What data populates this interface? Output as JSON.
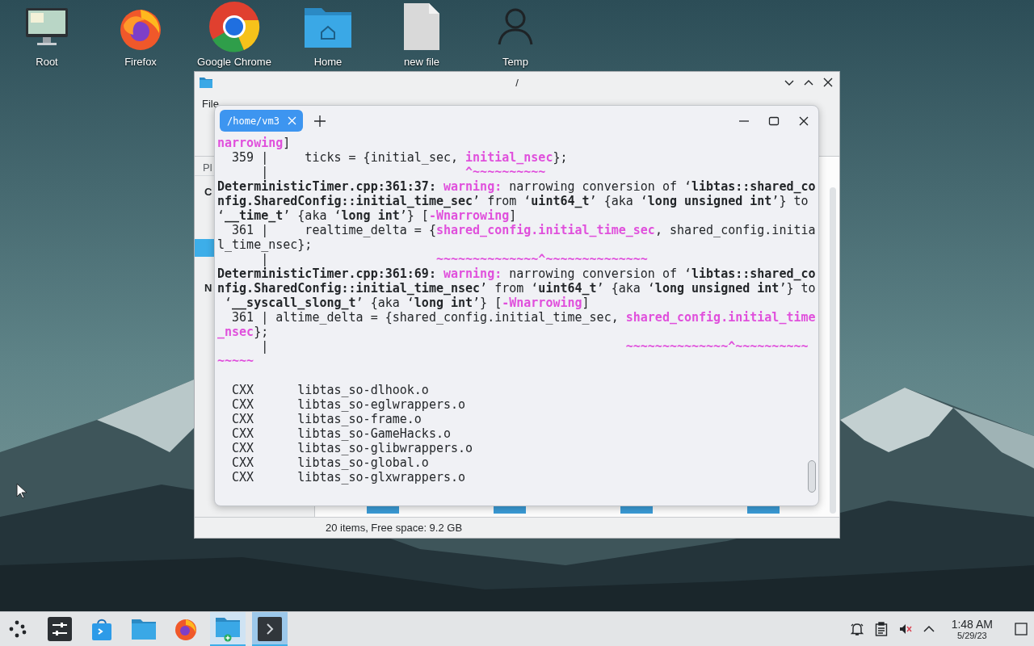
{
  "desktop_icons": [
    {
      "label": "Root",
      "kind": "monitor"
    },
    {
      "label": "Firefox",
      "kind": "fox"
    },
    {
      "label": "Google Chrome",
      "kind": "ring"
    },
    {
      "label": "Home",
      "kind": "home-folder"
    },
    {
      "label": "new file",
      "kind": "file"
    },
    {
      "label": "Temp",
      "kind": "user"
    }
  ],
  "file_manager": {
    "title": "/",
    "menu": [
      "File"
    ],
    "panel_heading": "Pl",
    "sidebar": [
      {
        "label": "C",
        "selected": false
      },
      {
        "selected": true
      },
      {
        "label": "N",
        "selected": false
      }
    ],
    "status": "20 items, Free space: 9.2 GB"
  },
  "terminal": {
    "tab": {
      "label": "/home/vm3",
      "selected": true
    },
    "lines": [
      [
        {
          "text": "narrowing",
          "kind": "highlight"
        },
        {
          "text": "]",
          "kind": "plain"
        }
      ],
      [
        {
          "text": "  359 |     ticks = {initial_sec, ",
          "kind": "plain"
        },
        {
          "text": "initial_nsec",
          "kind": "highlight"
        },
        {
          "text": "};",
          "kind": "plain"
        }
      ],
      [
        {
          "text": "      |                           ",
          "kind": "plain"
        },
        {
          "text": "^~~~~~~~~~~",
          "kind": "highlight"
        }
      ],
      [
        {
          "text": "DeterministicTimer.cpp:361:37: ",
          "kind": "bold"
        },
        {
          "text": "warning:",
          "kind": "highlight"
        },
        {
          "text": " narrowing conversion of ‘",
          "kind": "plain"
        },
        {
          "text": "libtas::shared_co",
          "kind": "bold"
        }
      ],
      [
        {
          "text": "nfig.SharedConfig::initial_time_sec",
          "kind": "bold"
        },
        {
          "text": "’ from ‘",
          "kind": "plain"
        },
        {
          "text": "uint64_t",
          "kind": "bold"
        },
        {
          "text": "’ {aka ‘",
          "kind": "plain"
        },
        {
          "text": "long unsigned int",
          "kind": "bold"
        },
        {
          "text": "’} to",
          "kind": "plain"
        }
      ],
      [
        {
          "text": "‘",
          "kind": "plain"
        },
        {
          "text": "__time_t",
          "kind": "bold"
        },
        {
          "text": "’ {aka ‘",
          "kind": "plain"
        },
        {
          "text": "long int",
          "kind": "bold"
        },
        {
          "text": "’} [",
          "kind": "plain"
        },
        {
          "text": "-Wnarrowing",
          "kind": "highlight"
        },
        {
          "text": "]",
          "kind": "plain"
        }
      ],
      [
        {
          "text": "  361 |     realtime_delta = {",
          "kind": "plain"
        },
        {
          "text": "shared_config.initial_time_sec",
          "kind": "highlight"
        },
        {
          "text": ", shared_config.initia",
          "kind": "plain"
        }
      ],
      [
        {
          "text": "l_time_nsec};",
          "kind": "plain"
        }
      ],
      [
        {
          "text": "      |                       ",
          "kind": "plain"
        },
        {
          "text": "~~~~~~~~~~~~~~^~~~~~~~~~~~~~~",
          "kind": "highlight"
        }
      ],
      [
        {
          "text": "DeterministicTimer.cpp:361:69: ",
          "kind": "bold"
        },
        {
          "text": "warning:",
          "kind": "highlight"
        },
        {
          "text": " narrowing conversion of ‘",
          "kind": "plain"
        },
        {
          "text": "libtas::shared_co",
          "kind": "bold"
        }
      ],
      [
        {
          "text": "nfig.SharedConfig::initial_time_nsec",
          "kind": "bold"
        },
        {
          "text": "’ from ‘",
          "kind": "plain"
        },
        {
          "text": "uint64_t",
          "kind": "bold"
        },
        {
          "text": "’ {aka ‘",
          "kind": "plain"
        },
        {
          "text": "long unsigned int",
          "kind": "bold"
        },
        {
          "text": "’} to",
          "kind": "plain"
        }
      ],
      [
        {
          "text": " ‘",
          "kind": "plain"
        },
        {
          "text": "__syscall_slong_t",
          "kind": "bold"
        },
        {
          "text": "’ {aka ‘",
          "kind": "plain"
        },
        {
          "text": "long int",
          "kind": "bold"
        },
        {
          "text": "’} [",
          "kind": "plain"
        },
        {
          "text": "-Wnarrowing",
          "kind": "highlight"
        },
        {
          "text": "]",
          "kind": "plain"
        }
      ],
      [
        {
          "text": "  361 | altime_delta = {shared_config.initial_time_sec, ",
          "kind": "plain"
        },
        {
          "text": "shared_config.initial_time",
          "kind": "highlight"
        }
      ],
      [
        {
          "text": "_nsec",
          "kind": "highlight"
        },
        {
          "text": "};",
          "kind": "plain"
        }
      ],
      [
        {
          "text": "      |                                                 ",
          "kind": "plain"
        },
        {
          "text": "~~~~~~~~~~~~~~^~~~~~~~~~~",
          "kind": "highlight"
        }
      ],
      [
        {
          "text": "~~~~~",
          "kind": "highlight"
        }
      ]
    ],
    "build_lines": [
      {
        "tool": "CXX",
        "file": "libtas_so-dlhook.o"
      },
      {
        "tool": "CXX",
        "file": "libtas_so-eglwrappers.o"
      },
      {
        "tool": "CXX",
        "file": "libtas_so-frame.o"
      },
      {
        "tool": "CXX",
        "file": "libtas_so-GameHacks.o"
      },
      {
        "tool": "CXX",
        "file": "libtas_so-glibwrappers.o"
      },
      {
        "tool": "CXX",
        "file": "libtas_so-global.o"
      },
      {
        "tool": "CXX",
        "file": "libtas_so-glxwrappers.o"
      }
    ]
  },
  "taskbar": {
    "items": [
      {
        "kind": "launcher",
        "open": false,
        "selected": false
      },
      {
        "kind": "settings",
        "open": false,
        "selected": false
      },
      {
        "kind": "store",
        "open": false,
        "selected": false
      },
      {
        "kind": "folder",
        "open": false,
        "selected": false
      },
      {
        "kind": "fox",
        "open": false,
        "selected": false
      },
      {
        "kind": "folder-plus",
        "open": true,
        "selected": false
      },
      {
        "kind": "terminal",
        "open": true,
        "selected": true
      }
    ],
    "tray": [
      {
        "kind": "bell"
      },
      {
        "kind": "clipboard"
      },
      {
        "kind": "muted"
      },
      {
        "kind": "caret"
      }
    ],
    "time": "1:48 AM",
    "date": "5/29/23"
  }
}
